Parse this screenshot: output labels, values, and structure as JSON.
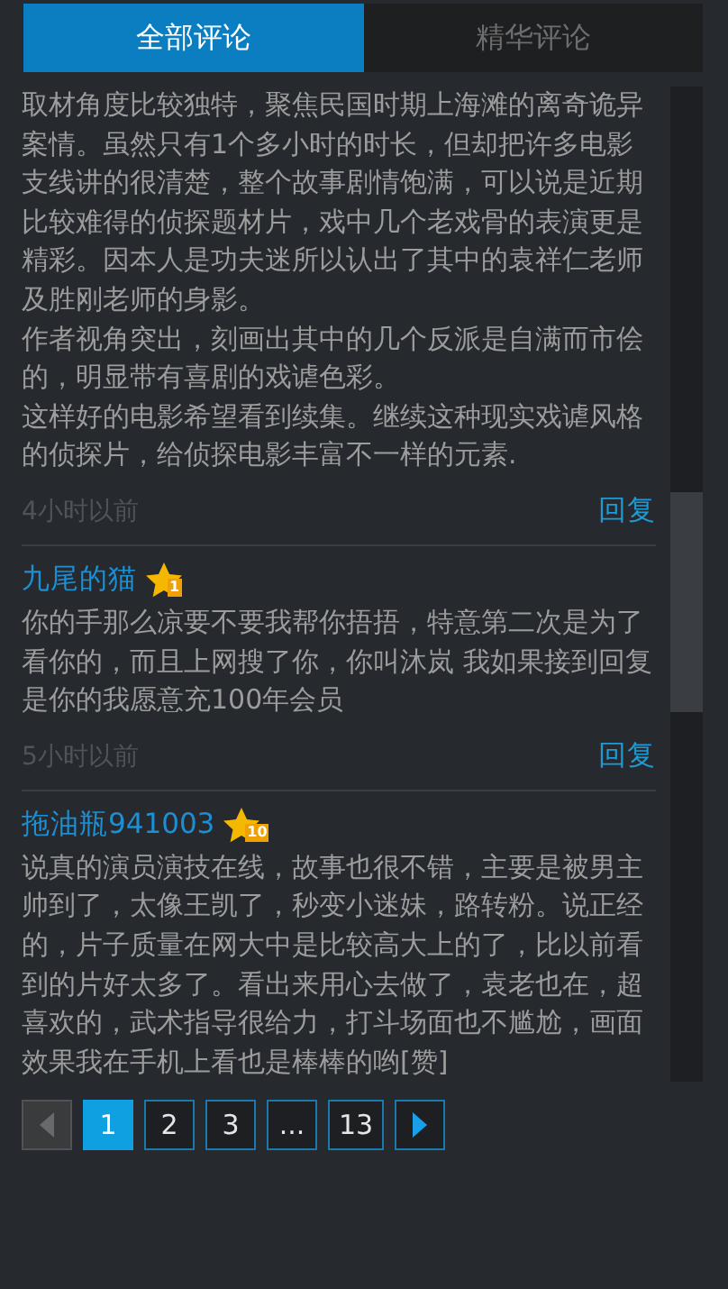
{
  "tabs": [
    {
      "label": "全部评论",
      "selected": true
    },
    {
      "label": "精华评论",
      "selected": false
    }
  ],
  "comments": [
    {
      "paragraphs": [
        "取材角度比较独特，聚焦民国时期上海滩的离奇诡异案情。虽然只有1个多小时的时长，但却把许多电影支线讲的很清楚，整个故事剧情饱满，可以说是近期比较难得的侦探题材片，戏中几个老戏骨的表演更是精彩。因本人是功夫迷所以认出了其中的袁祥仁老师及胜刚老师的身影。",
        "作者视角突出，刻画出其中的几个反派是自满而市侩的，明显带有喜剧的戏谑色彩。",
        "这样好的电影希望看到续集。继续这种现实戏谑风格的侦探片，给侦探电影丰富不一样的元素."
      ],
      "time": "4小时以前",
      "reply": "回复"
    },
    {
      "user": "九尾的猫",
      "badge": "1",
      "paragraphs": [
        "你的手那么凉要不要我帮你捂捂，特意第二次是为了看你的，而且上网搜了你，你叫沐岚 我如果接到回复是你的我愿意充100年会员"
      ],
      "time": "5小时以前",
      "reply": "回复"
    },
    {
      "user": "拖油瓶941003",
      "badge": "10",
      "paragraphs": [
        "说真的演员演技在线，故事也很不错，主要是被男主帅到了，太像王凯了，秒变小迷妹，路转粉。说正经的，片子质量在网大中是比较高大上的了，比以前看到的片好太多了。看出来用心去做了，袁老也在，超喜欢的，武术指导很给力，打斗场面也不尴尬，画面效果我在手机上看也是棒棒的哟[赞]"
      ]
    }
  ],
  "pager": {
    "prev_disabled": true,
    "next_disabled": false,
    "pages": [
      {
        "label": "1",
        "selected": true
      },
      {
        "label": "2",
        "selected": false
      },
      {
        "label": "3",
        "selected": false
      },
      {
        "label": "...",
        "selected": false
      },
      {
        "label": "13",
        "selected": false
      }
    ]
  }
}
